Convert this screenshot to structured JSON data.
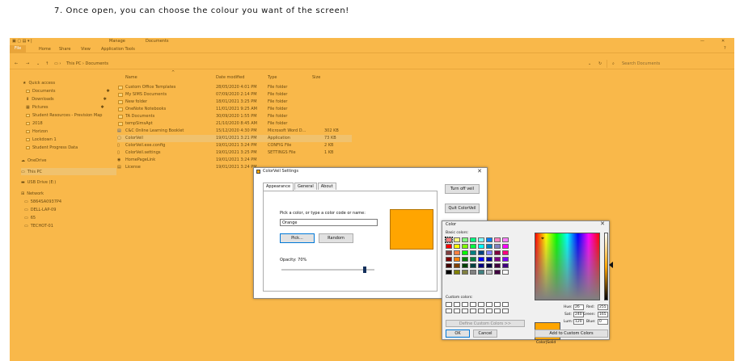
{
  "caption": "7.  Once open, you can choose the colour you want of the screen!",
  "explorer": {
    "title_tabs": [
      "Manage",
      "Documents"
    ],
    "ribbon_tabs": [
      "File",
      "Home",
      "Share",
      "View",
      "Application Tools"
    ],
    "address_path": "This PC  ›  Documents",
    "search_placeholder": "Search Documents",
    "nav_items": [
      {
        "label": "Quick access"
      },
      {
        "label": "Documents"
      },
      {
        "label": "Downloads"
      },
      {
        "label": "Pictures"
      },
      {
        "label": "Student Resources - Prevision Map"
      },
      {
        "label": "2018"
      },
      {
        "label": "Horizon"
      },
      {
        "label": "Lockdown 1"
      },
      {
        "label": "Student Progress Data"
      },
      {
        "label": "OneDrive"
      },
      {
        "label": "This PC"
      },
      {
        "label": "USB Drive (E:)"
      },
      {
        "label": "Network"
      },
      {
        "label": "5864SA0937P4"
      },
      {
        "label": "DELL-LAP-09"
      },
      {
        "label": "65"
      },
      {
        "label": "TECHOT-01"
      }
    ],
    "columns": {
      "name": "Name",
      "date": "Date modified",
      "type": "Type",
      "size": "Size"
    },
    "files": [
      {
        "name": "Custom Office Templates",
        "date": "28/05/2020 4:01 PM",
        "type": "File folder",
        "size": ""
      },
      {
        "name": "My SIMS Documents",
        "date": "07/09/2020 2:14 PM",
        "type": "File folder",
        "size": ""
      },
      {
        "name": "New folder",
        "date": "18/01/2021 3:25 PM",
        "type": "File folder",
        "size": ""
      },
      {
        "name": "OneNote Notebooks",
        "date": "11/01/2021 9:25 AM",
        "type": "File folder",
        "size": ""
      },
      {
        "name": "TA Documents",
        "date": "30/09/2020 1:55 PM",
        "type": "File folder",
        "size": ""
      },
      {
        "name": "tempSimsApt",
        "date": "21/10/2020 8:45 AM",
        "type": "File folder",
        "size": ""
      },
      {
        "name": "C&C Online Learning Booklet",
        "date": "15/12/2020 4:30 PM",
        "type": "Microsoft Word D...",
        "size": "302 KB"
      },
      {
        "name": "ColorVeil",
        "date": "19/01/2021 3:21 PM",
        "type": "Application",
        "size": "73 KB"
      },
      {
        "name": "ColorVeil.exe.config",
        "date": "19/01/2021 3:24 PM",
        "type": "CONFIG File",
        "size": "2 KB"
      },
      {
        "name": "ColorVeil.settings",
        "date": "19/01/2021 3:25 PM",
        "type": "SETTINGS File",
        "size": "1 KB"
      },
      {
        "name": "HomePageLink",
        "date": "19/01/2021 3:24 PM",
        "type": "",
        "size": ""
      },
      {
        "name": "License",
        "date": "19/01/2021 3:24 PM",
        "type": "",
        "size": ""
      }
    ]
  },
  "colorveil": {
    "title": "ColorVeil Settings",
    "tabs": [
      "Appearance",
      "General",
      "About"
    ],
    "prompt": "Pick a color, or type a color code or name:",
    "color_value": "Orange",
    "pick_label": "Pick...",
    "random_label": "Random",
    "opacity_label": "Opacity: 70%",
    "opacity_value": 0.7,
    "turn_off_label": "Turn off veil",
    "quit_label": "Quit ColorVeil",
    "swatch_color": "#ffa500"
  },
  "color_dialog": {
    "title": "Color",
    "basic_label": "Basic colors:",
    "custom_label": "Custom colors:",
    "define_label": "Define Custom Colors >>",
    "ok_label": "OK",
    "cancel_label": "Cancel",
    "colorsolid_label": "Color|Solid",
    "add_label": "Add to Custom Colors",
    "hue_label": "Hue:",
    "hue": "26",
    "sat_label": "Sat:",
    "sat": "240",
    "lum_label": "Lum:",
    "lum": "120",
    "red_label": "Red:",
    "red": "255",
    "green_label": "Green:",
    "green": "165",
    "blue_label": "Blue:",
    "blue": "0",
    "basic_colors": [
      "#ff8080",
      "#ffff80",
      "#80ff80",
      "#00ff80",
      "#80ffff",
      "#0080ff",
      "#ff80c0",
      "#ff80ff",
      "#ff0000",
      "#ffff00",
      "#80ff00",
      "#00ff40",
      "#00ffff",
      "#0080c0",
      "#8080c0",
      "#ff00ff",
      "#804040",
      "#ff8040",
      "#00ff00",
      "#008080",
      "#004080",
      "#8080ff",
      "#800040",
      "#ff0080",
      "#800000",
      "#ff8000",
      "#008000",
      "#008040",
      "#0000ff",
      "#0000a0",
      "#800080",
      "#8000ff",
      "#400000",
      "#804000",
      "#004000",
      "#004040",
      "#000080",
      "#000040",
      "#400040",
      "#400080",
      "#000000",
      "#808000",
      "#808040",
      "#808080",
      "#408080",
      "#c0c0c0",
      "#400040",
      "#ffffff"
    ]
  }
}
